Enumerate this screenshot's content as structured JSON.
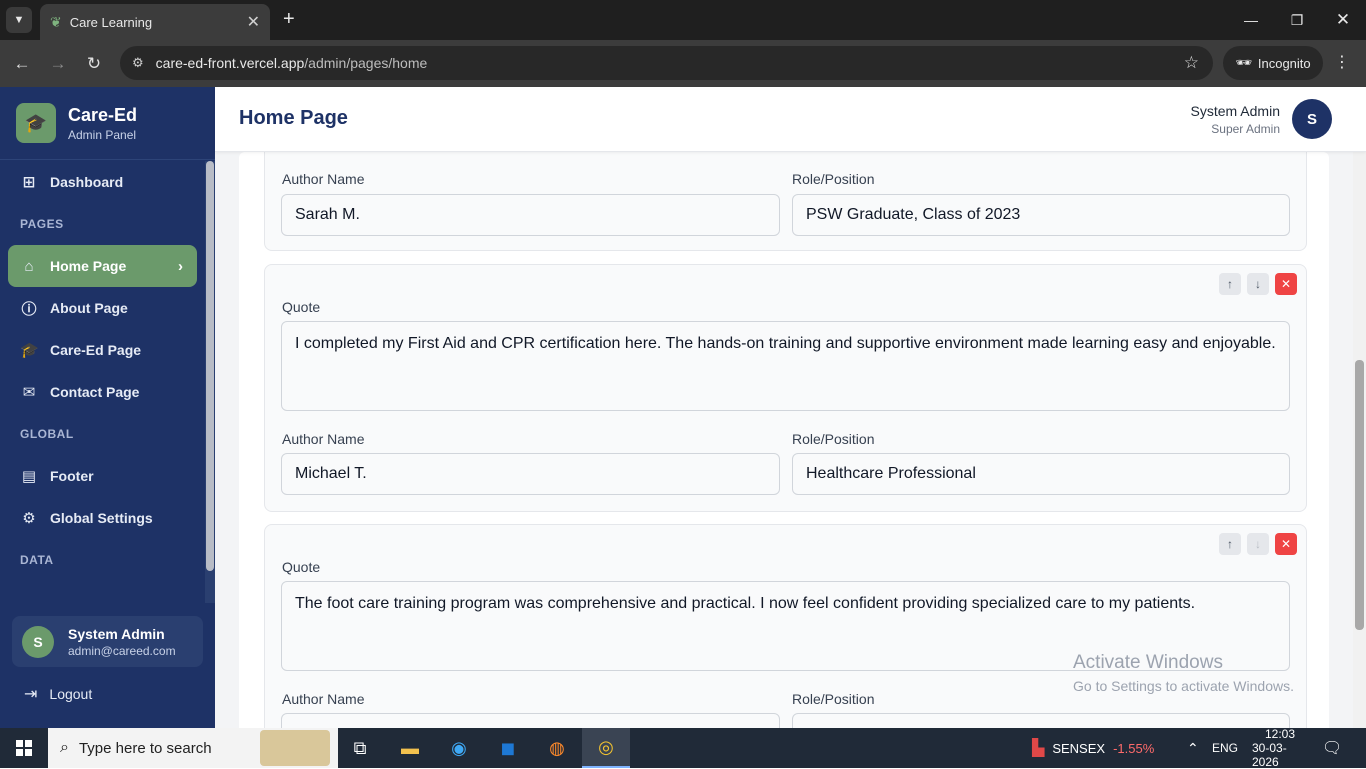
{
  "browser": {
    "tab_title": "Care Learning",
    "url_host": "care-ed-front.vercel.app",
    "url_path": "/admin/pages/home",
    "incognito_label": "Incognito"
  },
  "sidebar": {
    "brand_name": "Care-Ed",
    "brand_sub": "Admin Panel",
    "items": [
      {
        "label": "Dashboard",
        "icon": "grid-icon"
      },
      {
        "section": "PAGES"
      },
      {
        "label": "Home Page",
        "icon": "home-icon",
        "active": true
      },
      {
        "label": "About Page",
        "icon": "info-icon"
      },
      {
        "label": "Care-Ed Page",
        "icon": "graduation-cap-icon"
      },
      {
        "label": "Contact Page",
        "icon": "mail-icon"
      },
      {
        "section": "GLOBAL"
      },
      {
        "label": "Footer",
        "icon": "layout-icon"
      },
      {
        "label": "Global Settings",
        "icon": "gear-icon"
      },
      {
        "section": "DATA"
      }
    ],
    "labels": {
      "dashboard": "Dashboard",
      "pages": "PAGES",
      "home": "Home Page",
      "about": "About Page",
      "careed": "Care-Ed Page",
      "contact": "Contact Page",
      "global": "GLOBAL",
      "footer": "Footer",
      "settings": "Global Settings",
      "data": "DATA"
    },
    "user": {
      "initial": "S",
      "name": "System Admin",
      "email": "admin@careed.com"
    },
    "logout": "Logout"
  },
  "header": {
    "title": "Home Page",
    "user_name": "System Admin",
    "user_role": "Super Admin",
    "avatar_initial": "S"
  },
  "testimonials": {
    "quote_label": "Quote",
    "author_label": "Author Name",
    "role_label": "Role/Position",
    "items": [
      {
        "quote": "",
        "author": "Sarah M.",
        "role": "PSW Graduate, Class of 2023"
      },
      {
        "quote": "I completed my First Aid and CPR certification here. The hands-on training and supportive environment made learning easy and enjoyable.",
        "author": "Michael T.",
        "role": "Healthcare Professional"
      },
      {
        "quote": "The foot care training program was comprehensive and practical. I now feel confident providing specialized care to my patients.",
        "author": "",
        "role": ""
      }
    ]
  },
  "watermark": {
    "title": "Activate Windows",
    "sub": "Go to Settings to activate Windows."
  },
  "taskbar": {
    "search_placeholder": "Type here to search",
    "ticker": "SENSEX",
    "ticker_change": "-1.55%",
    "lang": "ENG",
    "time": "12:03",
    "date": "30-03-2026"
  },
  "colors": {
    "sidebar": "#1e3266",
    "accent": "#6b9a6b",
    "danger": "#ef4444"
  }
}
